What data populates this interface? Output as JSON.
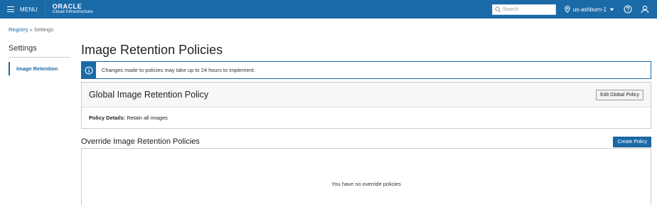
{
  "topbar": {
    "menu_label": "MENU",
    "brand_name": "ORACLE",
    "brand_sub": "Cloud Infrastructure",
    "search_placeholder": "Search",
    "region": "us-ashburn-1",
    "icons": [
      "hamburger-icon",
      "search-icon",
      "location-pin-icon",
      "chevron-down-icon",
      "help-icon",
      "user-icon"
    ],
    "color": "#1a6aa8"
  },
  "breadcrumb": {
    "link": "Registry",
    "separator": "»",
    "current": "Settings"
  },
  "sidebar": {
    "title": "Settings",
    "items": [
      {
        "label": "Image Retention",
        "active": true
      }
    ]
  },
  "main": {
    "title": "Image Retention Policies",
    "info_banner": {
      "icon": "info-icon",
      "text": "Changes made to policies may take up to 24 hours to implement."
    },
    "global_policy": {
      "title": "Global Image Retention Policy",
      "edit_button": "Edit Global Policy",
      "details_label": "Policy Details:",
      "details_value": "Retain all images"
    },
    "override": {
      "title": "Override Image Retention Policies",
      "create_button": "Create Policy",
      "empty_message": "You have no override policies"
    }
  },
  "colors": {
    "accent": "#1a6aa8",
    "border": "#cccccc",
    "panel_header": "#f7f7f7"
  }
}
